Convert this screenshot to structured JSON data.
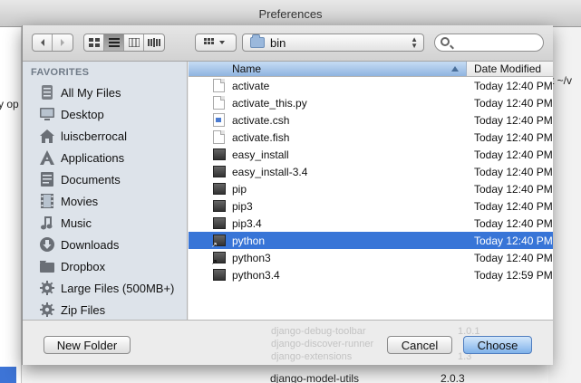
{
  "window": {
    "title": "Preferences"
  },
  "background": {
    "left_partial_text": "y op",
    "right_partial_text": "t ~/v",
    "bottom_row": {
      "name": "django-model-utils",
      "version": "2.0.3"
    },
    "ghost_rows": [
      {
        "name": "django-debug-toolbar",
        "version": "1.0.1"
      },
      {
        "name": "django-discover-runner",
        "version": "1.0"
      },
      {
        "name": "django-extensions",
        "version": "1.3"
      }
    ]
  },
  "toolbar": {
    "back_icon": "chevron-left-icon",
    "forward_icon": "chevron-right-icon",
    "views": [
      "icon-view",
      "list-view",
      "column-view",
      "coverflow-view"
    ],
    "active_view": "list-view",
    "action_icon": "grid-action-icon",
    "path_label": "bin",
    "search_placeholder": ""
  },
  "sidebar": {
    "heading": "FAVORITES",
    "items": [
      {
        "label": "All My Files",
        "icon": "all-files-icon"
      },
      {
        "label": "Desktop",
        "icon": "desktop-icon"
      },
      {
        "label": "luiscberrocal",
        "icon": "home-icon"
      },
      {
        "label": "Applications",
        "icon": "applications-icon"
      },
      {
        "label": "Documents",
        "icon": "documents-icon"
      },
      {
        "label": "Movies",
        "icon": "movies-icon"
      },
      {
        "label": "Music",
        "icon": "music-icon"
      },
      {
        "label": "Downloads",
        "icon": "downloads-icon"
      },
      {
        "label": "Dropbox",
        "icon": "folder-icon"
      },
      {
        "label": "Large Files (500MB+)",
        "icon": "gear-icon"
      },
      {
        "label": "Zip Files",
        "icon": "gear-icon"
      }
    ]
  },
  "files": {
    "columns": {
      "name": "Name",
      "date": "Date Modified"
    },
    "sort_column": "Name",
    "rows": [
      {
        "name": "activate",
        "date": "Today 12:40 PM",
        "kind": "document"
      },
      {
        "name": "activate_this.py",
        "date": "Today 12:40 PM",
        "kind": "document"
      },
      {
        "name": "activate.csh",
        "date": "Today 12:40 PM",
        "kind": "script"
      },
      {
        "name": "activate.fish",
        "date": "Today 12:40 PM",
        "kind": "document"
      },
      {
        "name": "easy_install",
        "date": "Today 12:40 PM",
        "kind": "executable"
      },
      {
        "name": "easy_install-3.4",
        "date": "Today 12:40 PM",
        "kind": "executable"
      },
      {
        "name": "pip",
        "date": "Today 12:40 PM",
        "kind": "executable"
      },
      {
        "name": "pip3",
        "date": "Today 12:40 PM",
        "kind": "executable"
      },
      {
        "name": "pip3.4",
        "date": "Today 12:40 PM",
        "kind": "executable"
      },
      {
        "name": "python",
        "date": "Today 12:40 PM",
        "kind": "alias",
        "selected": true
      },
      {
        "name": "python3",
        "date": "Today 12:40 PM",
        "kind": "alias"
      },
      {
        "name": "python3.4",
        "date": "Today 12:59 PM",
        "kind": "executable"
      }
    ]
  },
  "buttons": {
    "new_folder": "New Folder",
    "cancel": "Cancel",
    "choose": "Choose"
  },
  "colors": {
    "selection": "#3875d7",
    "sidebar_bg": "#dde3ea",
    "default_button": "#7fb1ea"
  }
}
